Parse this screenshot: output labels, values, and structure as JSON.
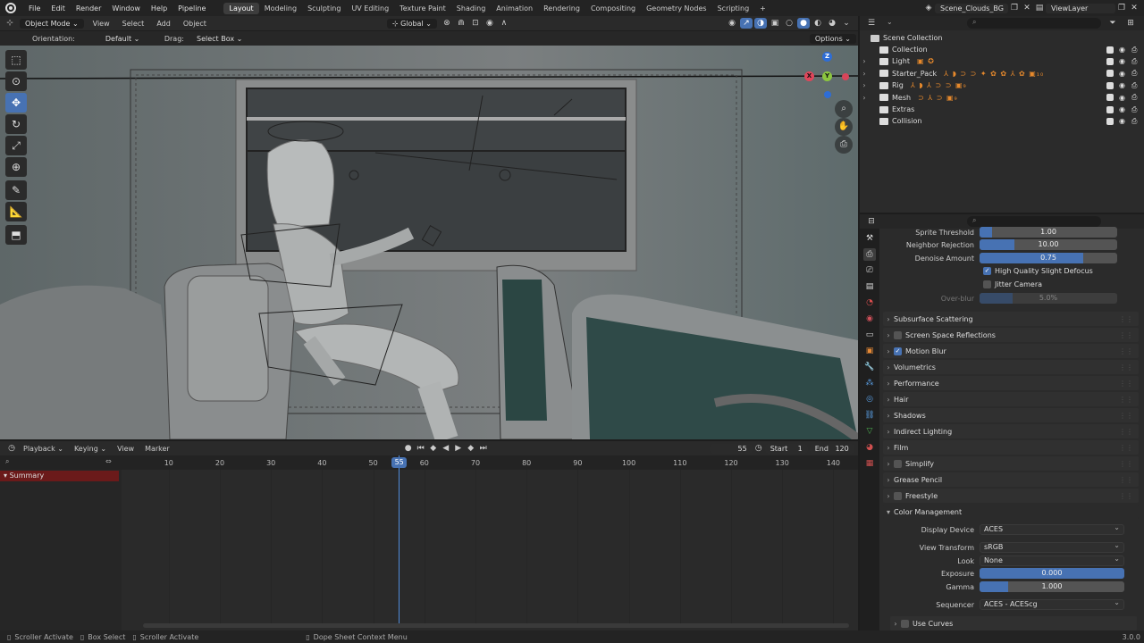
{
  "topbar": {
    "menus": [
      "File",
      "Edit",
      "Render",
      "Window",
      "Help",
      "Pipeline"
    ],
    "workspaces": [
      "Layout",
      "Modeling",
      "Sculpting",
      "UV Editing",
      "Texture Paint",
      "Shading",
      "Animation",
      "Rendering",
      "Compositing",
      "Geometry Nodes",
      "Scripting"
    ],
    "active_workspace": "Layout",
    "add_tab": "+",
    "scene": "Scene_Clouds_BG",
    "view_layer": "ViewLayer"
  },
  "viewport_header": {
    "mode": "Object Mode",
    "menus": [
      "View",
      "Select",
      "Add",
      "Object"
    ],
    "transform_orientation": "Global"
  },
  "tool_settings": {
    "orientation_label": "Orientation:",
    "orientation_value": "Default",
    "drag_label": "Drag:",
    "drag_value": "Select Box",
    "options": "Options"
  },
  "gizmo": {
    "x": "X",
    "y": "Y",
    "z": "Z"
  },
  "timeline": {
    "menus": [
      "Playback",
      "Keying",
      "View",
      "Marker"
    ],
    "current_frame": "55",
    "start_label": "Start",
    "start": "1",
    "end_label": "End",
    "end": "120",
    "frame_ticks": [
      "10",
      "20",
      "30",
      "40",
      "50",
      "60",
      "70",
      "80",
      "90",
      "100",
      "110",
      "120",
      "130",
      "140"
    ],
    "summary": "Summary"
  },
  "outliner": {
    "root": "Scene Collection",
    "items": [
      {
        "name": "Collection",
        "mods": ""
      },
      {
        "name": "Light",
        "mods": "▣ ✪"
      },
      {
        "name": "Starter_Pack",
        "mods": "⅄ ◗ ⊃ ⊃ ✦ ✿ ✿ ⅄ ✿ ▣₁₀"
      },
      {
        "name": "Rig",
        "mods": "⅄ ◗ ⅄ ⊃ ⊃ ▣₉"
      },
      {
        "name": "Mesh",
        "mods": "⊃ ⅄ ⊃ ▣₉"
      },
      {
        "name": "Extras",
        "mods": ""
      },
      {
        "name": "Collision",
        "mods": ""
      }
    ]
  },
  "properties": {
    "sprite_threshold": {
      "label": "Sprite Threshold",
      "value": "1.00",
      "fill": 0.09
    },
    "neighbor_rejection": {
      "label": "Neighbor Rejection",
      "value": "10.00",
      "fill": 0.25
    },
    "denoise_amount": {
      "label": "Denoise Amount",
      "value": "0.75",
      "fill": 0.75
    },
    "high_quality": "High Quality Slight Defocus",
    "jitter_camera": "Jitter Camera",
    "over_blur": {
      "label": "Over-blur",
      "value": "5.0%",
      "fill": 0.24
    },
    "panels": [
      {
        "label": "Subsurface Scattering",
        "checkbox": "none"
      },
      {
        "label": "Screen Space Reflections",
        "checkbox": "off"
      },
      {
        "label": "Motion Blur",
        "checkbox": "on"
      },
      {
        "label": "Volumetrics",
        "checkbox": "none"
      },
      {
        "label": "Performance",
        "checkbox": "none"
      },
      {
        "label": "Hair",
        "checkbox": "none"
      },
      {
        "label": "Shadows",
        "checkbox": "none"
      },
      {
        "label": "Indirect Lighting",
        "checkbox": "none"
      },
      {
        "label": "Film",
        "checkbox": "none"
      },
      {
        "label": "Simplify",
        "checkbox": "off"
      },
      {
        "label": "Grease Pencil",
        "checkbox": "none"
      },
      {
        "label": "Freestyle",
        "checkbox": "off"
      }
    ],
    "color_management": {
      "title": "Color Management",
      "display_device_label": "Display Device",
      "display_device": "ACES",
      "view_transform_label": "View Transform",
      "view_transform": "sRGB",
      "look_label": "Look",
      "look": "None",
      "exposure_label": "Exposure",
      "exposure": "0.000",
      "gamma_label": "Gamma",
      "gamma": "1.000",
      "sequencer_label": "Sequencer",
      "sequencer": "ACES - ACEScg",
      "use_curves": "Use Curves"
    }
  },
  "statusbar": {
    "hints": [
      "Scroller Activate",
      "Box Select",
      "Scroller Activate",
      "Dope Sheet Context Menu"
    ],
    "version": "3.0.0"
  },
  "colors": {
    "accent": "#4772b3",
    "summary": "#6b1a1a",
    "viewport": "#6b7172"
  }
}
